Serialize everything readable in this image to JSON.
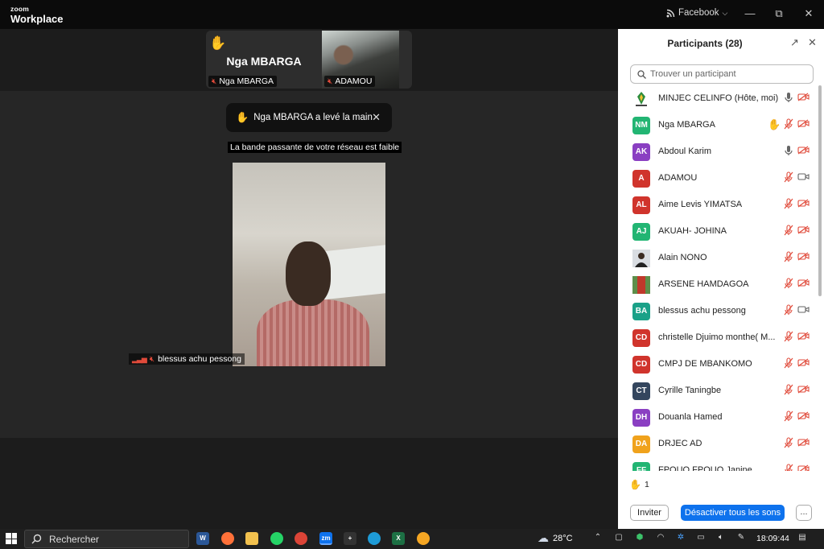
{
  "app": {
    "logo_top": "zoom",
    "logo_bottom": "Workplace",
    "account": "Facebook",
    "window_controls": [
      "minimize-icon",
      "restore-icon",
      "close-icon"
    ]
  },
  "meeting": {
    "thumb1_name_big": "Nga MBARGA",
    "thumb1_label": "Nga MBARGA",
    "thumb2_label": "ADAMOU",
    "notification": "Nga MBARGA a levé la main",
    "bandwidth_warning": "La bande passante de votre réseau est faible",
    "active_speaker_label": "blessus achu pessong"
  },
  "panel": {
    "title": "Participants (28)",
    "search_placeholder": "Trouver un participant",
    "participants": [
      {
        "name": "MINJEC CELINFO (Hôte, moi)",
        "initials": "",
        "color": "#ffffff",
        "raised": false,
        "mic": "on",
        "video": "off"
      },
      {
        "name": "Nga MBARGA",
        "initials": "NM",
        "color": "#22b573",
        "raised": true,
        "mic": "muted",
        "video": "off"
      },
      {
        "name": "Abdoul Karim",
        "initials": "AK",
        "color": "#8a3fc2",
        "raised": false,
        "mic": "on",
        "video": "off"
      },
      {
        "name": "ADAMOU",
        "initials": "A",
        "color": "#d0342c",
        "raised": false,
        "mic": "muted",
        "video": "on"
      },
      {
        "name": "Aime Levis YIMATSA",
        "initials": "AL",
        "color": "#d0342c",
        "raised": false,
        "mic": "muted",
        "video": "off"
      },
      {
        "name": "AKUAH- JOHINA",
        "initials": "AJ",
        "color": "#22b573",
        "raised": false,
        "mic": "muted",
        "video": "off"
      },
      {
        "name": "Alain NONO",
        "initials": "",
        "color": "#3a3a3a",
        "raised": false,
        "mic": "muted",
        "video": "off"
      },
      {
        "name": "ARSENE HAMDAGOA",
        "initials": "",
        "color": "#5d8f4a",
        "raised": false,
        "mic": "muted",
        "video": "off"
      },
      {
        "name": "blessus achu pessong",
        "initials": "BA",
        "color": "#1aa188",
        "raised": false,
        "mic": "muted",
        "video": "on"
      },
      {
        "name": "christelle    Djuimo monthe( M...",
        "initials": "CD",
        "color": "#d0342c",
        "raised": false,
        "mic": "muted",
        "video": "off"
      },
      {
        "name": "CMPJ DE MBANKOMO",
        "initials": "CD",
        "color": "#d0342c",
        "raised": false,
        "mic": "muted",
        "video": "off"
      },
      {
        "name": "Cyrille Taningbe",
        "initials": "CT",
        "color": "#34465e",
        "raised": false,
        "mic": "muted",
        "video": "off"
      },
      {
        "name": "Douanla Hamed",
        "initials": "DH",
        "color": "#8a3fc2",
        "raised": false,
        "mic": "muted",
        "video": "off"
      },
      {
        "name": "DRJEC AD",
        "initials": "DA",
        "color": "#f0a21c",
        "raised": false,
        "mic": "muted",
        "video": "off"
      },
      {
        "name": "FPOUO FPOUO Janine",
        "initials": "FF",
        "color": "#22b573",
        "raised": false,
        "mic": "muted",
        "video": "off"
      }
    ],
    "raised_hands_count": "1",
    "invite_label": "Inviter",
    "mute_all_label": "Désactiver tous les sons",
    "more_label": "..."
  },
  "taskbar": {
    "search_label": "Rechercher",
    "weather_temp": "28°C",
    "time": "18:09:44",
    "apps": [
      {
        "name": "word-icon",
        "label": "W",
        "color": "#2b5797"
      },
      {
        "name": "firefox-icon",
        "label": "",
        "color": "#ff7139"
      },
      {
        "name": "file-explorer-icon",
        "label": "",
        "color": "#f2c14e"
      },
      {
        "name": "whatsapp-icon",
        "label": "",
        "color": "#25d366"
      },
      {
        "name": "chrome-icon",
        "label": "",
        "color": "#db4437"
      },
      {
        "name": "zoom-icon",
        "label": "zm",
        "color": "#0e72ed"
      },
      {
        "name": "slack-icon",
        "label": "+",
        "color": "#333333"
      },
      {
        "name": "edge-icon",
        "label": "",
        "color": "#1e9bd7"
      },
      {
        "name": "excel-icon",
        "label": "X",
        "color": "#1d7044"
      },
      {
        "name": "vlc-icon",
        "label": "",
        "color": "#f5a623"
      }
    ]
  }
}
